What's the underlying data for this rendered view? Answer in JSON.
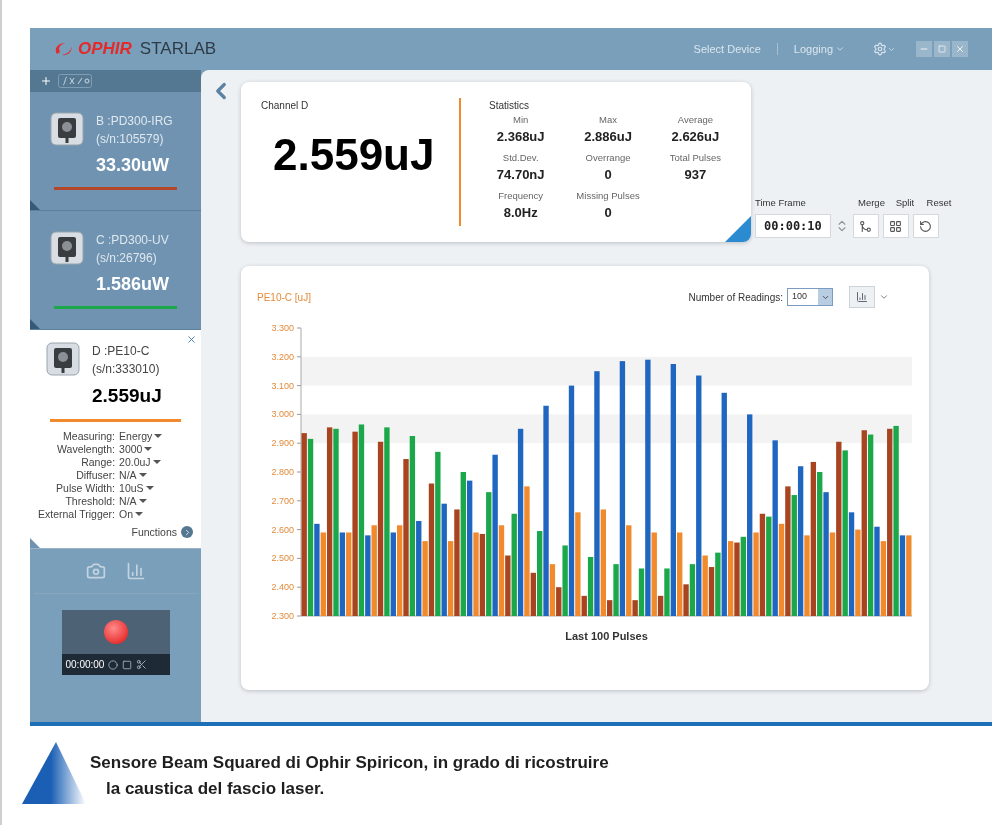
{
  "app": {
    "logo_brand": "OPHIR",
    "logo_product": "STARLAB"
  },
  "topbar": {
    "select_device": "Select Device",
    "logging": "Logging"
  },
  "channels": [
    {
      "name": "B :PD300-IRG",
      "serial": "(s/n:105579)",
      "reading": "33.30uW",
      "color": "#b5462a",
      "expanded": false
    },
    {
      "name": "C :PD300-UV",
      "serial": "(s/n:26796)",
      "reading": "1.586uW",
      "color": "#1aa84a",
      "expanded": false
    },
    {
      "name": "D :PE10-C",
      "serial": "(s/n:333010)",
      "reading": "2.559uJ",
      "color": "#f08a2c",
      "expanded": true,
      "settings": [
        {
          "label": "Measuring:",
          "value": "Energy"
        },
        {
          "label": "Wavelength:",
          "value": "3000"
        },
        {
          "label": "Range:",
          "value": "20.0uJ"
        },
        {
          "label": "Diffuser:",
          "value": "N/A"
        },
        {
          "label": "Pulse Width:",
          "value": "10uS"
        },
        {
          "label": "Threshold:",
          "value": "N/A"
        },
        {
          "label": "External Trigger:",
          "value": "On"
        }
      ],
      "functions": "Functions"
    }
  ],
  "record": {
    "time": "00:00:00"
  },
  "stats": {
    "channel": "Channel D",
    "value": "2.559uJ",
    "title": "Statistics",
    "items": [
      {
        "label": "Min",
        "value": "2.368uJ"
      },
      {
        "label": "Max",
        "value": "2.886uJ"
      },
      {
        "label": "Average",
        "value": "2.626uJ"
      },
      {
        "label": "Std.Dev.",
        "value": "74.70nJ"
      },
      {
        "label": "Overrange",
        "value": "0"
      },
      {
        "label": "Total Pulses",
        "value": "937"
      },
      {
        "label": "Frequency",
        "value": "8.0Hz"
      },
      {
        "label": "Missing Pulses",
        "value": "0"
      }
    ]
  },
  "time_frame": {
    "label": "Time Frame",
    "value": "00:00:10",
    "buttons": [
      {
        "kind": "merge",
        "label": "Merge"
      },
      {
        "kind": "split",
        "label": "Split"
      },
      {
        "kind": "reset",
        "label": "Reset"
      }
    ]
  },
  "chart_panel": {
    "readings_label": "Number of Readings:",
    "readings_value": "100",
    "chart_data": {
      "type": "bar",
      "title": "PE10-C [uJ]",
      "xlabel": "Last 100 Pulses",
      "ylim": [
        2.3,
        3.3
      ],
      "yticks": [
        {
          "value": 2.3,
          "label": "2.300"
        },
        {
          "value": 2.4,
          "label": "2.400"
        },
        {
          "value": 2.5,
          "label": "2.500"
        },
        {
          "value": 2.6,
          "label": "2.600"
        },
        {
          "value": 2.7,
          "label": "2.700"
        },
        {
          "value": 2.8,
          "label": "2.800"
        },
        {
          "value": 2.9,
          "label": "2.900"
        },
        {
          "value": 3.0,
          "label": "3.000"
        },
        {
          "value": 3.1,
          "label": "3.100"
        },
        {
          "value": 3.2,
          "label": "3.200"
        },
        {
          "value": 3.3,
          "label": "3.300"
        }
      ],
      "series": [
        {
          "color": "#a8441f",
          "values": [
            2.935,
            2.955,
            2.94,
            2.905,
            2.845,
            2.76,
            2.67,
            2.585,
            2.51,
            2.45,
            2.4,
            2.37,
            2.355,
            2.355,
            2.37,
            2.41,
            2.47,
            2.555,
            2.655,
            2.75,
            2.835,
            2.905,
            2.945,
            2.95
          ]
        },
        {
          "color": "#1aa84a",
          "values": [
            2.915,
            2.95,
            2.965,
            2.955,
            2.925,
            2.87,
            2.8,
            2.73,
            2.655,
            2.595,
            2.545,
            2.505,
            2.48,
            2.465,
            2.465,
            2.48,
            2.52,
            2.575,
            2.645,
            2.72,
            2.8,
            2.875,
            2.93,
            2.96
          ]
        },
        {
          "color": "#1f66c1",
          "values": [
            2.62,
            2.59,
            2.58,
            2.59,
            2.63,
            2.69,
            2.77,
            2.86,
            2.95,
            3.03,
            3.1,
            3.15,
            3.185,
            3.19,
            3.175,
            3.135,
            3.075,
            3.0,
            2.91,
            2.82,
            2.73,
            2.66,
            2.61,
            2.58
          ]
        },
        {
          "color": "#f08a2c",
          "values": [
            2.59,
            2.59,
            2.615,
            2.615,
            2.56,
            2.56,
            2.59,
            2.615,
            2.75,
            2.48,
            2.66,
            2.67,
            2.615,
            2.59,
            2.59,
            2.51,
            2.56,
            2.59,
            2.62,
            2.58,
            2.59,
            2.6,
            2.56,
            2.58
          ]
        }
      ]
    }
  },
  "caption": [
    "Sensore Beam Squared di Ophir Spiricon, in grado di ricostruire",
    "la caustica del fascio laser."
  ]
}
